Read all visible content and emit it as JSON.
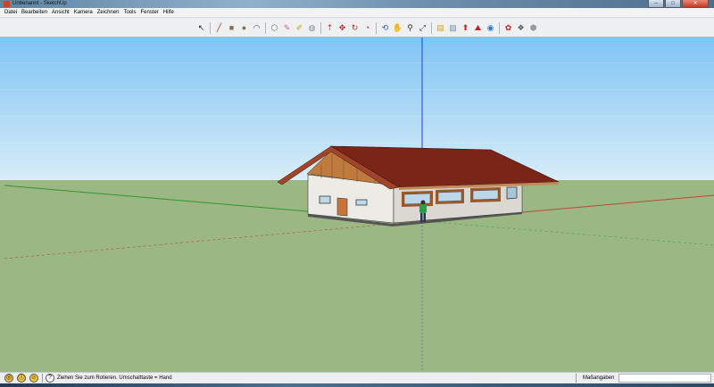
{
  "window": {
    "title": "Unbenannt - SketchUp",
    "buttons": {
      "minimize": "–",
      "maximize": "□",
      "close": "✕"
    }
  },
  "menu": [
    "Datei",
    "Bearbeiten",
    "Ansicht",
    "Kamera",
    "Zeichnen",
    "Tools",
    "Fenster",
    "Hilfe"
  ],
  "toolbar": {
    "tools": [
      {
        "name": "select-tool-icon",
        "glyph": "↖",
        "color": "#222222"
      },
      {
        "sep": true
      },
      {
        "name": "pencil-line-tool-icon",
        "glyph": "╱",
        "color": "#c0262d"
      },
      {
        "name": "rectangle-tool-icon",
        "glyph": "■",
        "color": "#8a6f4e"
      },
      {
        "name": "circle-tool-icon",
        "glyph": "●",
        "color": "#8a6f4e"
      },
      {
        "name": "arc-tool-icon",
        "glyph": "◠",
        "color": "#444444"
      },
      {
        "sep": true
      },
      {
        "name": "make-component-icon",
        "glyph": "⬡",
        "color": "#777777"
      },
      {
        "name": "eraser-tool-icon",
        "glyph": "✎",
        "color": "#d2628d"
      },
      {
        "name": "tape-measure-icon",
        "glyph": "✐",
        "color": "#caa01f"
      },
      {
        "name": "paint-bucket-icon",
        "glyph": "◍",
        "color": "#888888"
      },
      {
        "sep": true
      },
      {
        "name": "push-pull-tool-icon",
        "glyph": "⇡",
        "color": "#c0262d"
      },
      {
        "name": "move-tool-icon",
        "glyph": "✥",
        "color": "#c0262d"
      },
      {
        "name": "rotate-tool-icon",
        "glyph": "↻",
        "color": "#c0262d"
      },
      {
        "name": "offset-tool-icon",
        "glyph": "◔",
        "color": "#c0262d"
      },
      {
        "sep": true
      },
      {
        "name": "orbit-tool-icon",
        "glyph": "⟲",
        "color": "#2b5fb4"
      },
      {
        "name": "pan-tool-icon",
        "glyph": "✋",
        "color": "#555555"
      },
      {
        "name": "zoom-tool-icon",
        "glyph": "⚲",
        "color": "#333333"
      },
      {
        "name": "zoom-extents-icon",
        "glyph": "⤢",
        "color": "#333333"
      },
      {
        "sep": true
      },
      {
        "name": "get-models-icon",
        "glyph": "▤",
        "color": "#d6a21a"
      },
      {
        "name": "share-model-icon",
        "glyph": "▧",
        "color": "#7a8fa7"
      },
      {
        "name": "add-location-icon",
        "glyph": "⬆",
        "color": "#c0262d"
      },
      {
        "name": "toggle-terrain-icon",
        "glyph": "⛰",
        "color": "#c0262d"
      },
      {
        "name": "google-earth-icon",
        "glyph": "◉",
        "color": "#2b74c4"
      },
      {
        "sep": true
      },
      {
        "name": "extension-warehouse-icon",
        "glyph": "✿",
        "color": "#c0262d"
      },
      {
        "name": "layout-icon",
        "glyph": "❖",
        "color": "#555555"
      },
      {
        "name": "style-builder-icon",
        "glyph": "⬢",
        "color": "#999999"
      }
    ]
  },
  "status": {
    "icon_geo": "◎",
    "icon_credits": "ⓘ",
    "icon_user": "☺",
    "icon_help": "?",
    "text": "Ziehen Sie zum Rotieren.  Umschalttaste = Hand",
    "measurements_label": "Maßangaben",
    "measurements_value": ""
  },
  "colors": {
    "sky_top": "#7fc4f4",
    "sky_horizon": "#d8edf8",
    "ground": "#9ab784",
    "roof": "#7b2418",
    "wall": "#ecebe6",
    "gable_wood": "#bf7a3e",
    "axis_blue": "#2340c8",
    "axis_green": "#2f9a2f",
    "axis_red": "#b44d3c"
  }
}
